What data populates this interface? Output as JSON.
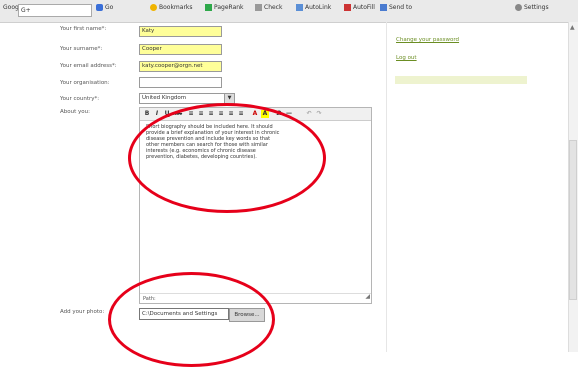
{
  "toolbar": {
    "google_label": "Google",
    "search_value": "G+",
    "go_label": "Go",
    "bookmarks_label": "Bookmarks",
    "pagerank_label": "PageRank",
    "check_label": "Check",
    "autolink_label": "AutoLink",
    "autofill_label": "AutoFill",
    "send_to_label": "Send to",
    "settings_label": "Settings"
  },
  "form": {
    "first_name_label": "Your first name*:",
    "first_name_value": "Katy",
    "surname_label": "Your surname*:",
    "surname_value": "Cooper",
    "email_label": "Your email address*:",
    "email_value": "katy.cooper@orgn.net",
    "organisation_label": "Your organisation:",
    "organisation_value": "",
    "country_label": "Your country*:",
    "country_value": "United Kingdom",
    "about_label": "About you:",
    "photo_label": "Add your photo:"
  },
  "editor": {
    "text": "Short biography should be included here. It should provide a brief explanation of your interest in chronic disease prevention and include key words so that other members can search for those with similar interests (e.g. economics of chronic disease prevention, diabetes, developing countries).",
    "path_label": "Path:",
    "buttons": [
      "B",
      "I",
      "U",
      "ABC",
      "≡",
      "≡",
      "≡",
      "≡",
      "≡",
      "≡",
      "A",
      "A",
      "Ω",
      "—",
      "↶",
      "↷"
    ]
  },
  "file_upload": {
    "path_value": "C:\\Documents and Settings",
    "browse_label": "Browse..."
  },
  "sidebar": {
    "change_password_link": "Change your password",
    "logout_link": "Log out"
  },
  "colors": {
    "field_highlight": "#ffff99",
    "annotation_red": "#e6001a",
    "link_green": "#6b8e23"
  }
}
